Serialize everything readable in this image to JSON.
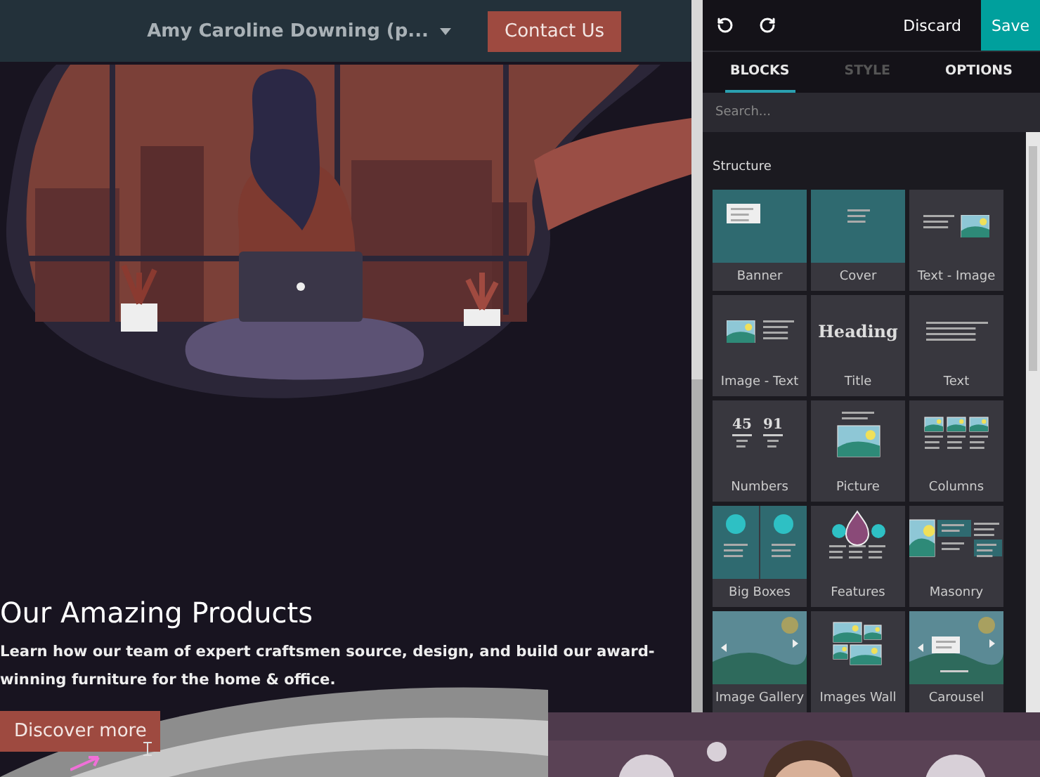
{
  "navbar": {
    "menu": "Amy Caroline Downing (p...",
    "cta": "Contact Us"
  },
  "hero": {
    "heading": "Our Amazing Products",
    "text": "Learn how our team of expert craftsmen source, design, and build our award-winning furniture for the home & office.",
    "button": "Discover more"
  },
  "editor": {
    "toolbar": {
      "discard": "Discard",
      "save": "Save"
    },
    "tabs": [
      {
        "label": "BLOCKS",
        "selected": true,
        "disabled": false
      },
      {
        "label": "STYLE",
        "selected": false,
        "disabled": true
      },
      {
        "label": "OPTIONS",
        "selected": false,
        "disabled": false
      }
    ],
    "search": {
      "placeholder": "Search..."
    },
    "section": "Structure",
    "blocks": [
      {
        "label": "Banner",
        "kind": "banner"
      },
      {
        "label": "Cover",
        "kind": "cover"
      },
      {
        "label": "Text - Image",
        "kind": "text-image"
      },
      {
        "label": "Image - Text",
        "kind": "image-text"
      },
      {
        "label": "Title",
        "kind": "title",
        "sample": "Heading"
      },
      {
        "label": "Text",
        "kind": "text"
      },
      {
        "label": "Numbers",
        "kind": "numbers",
        "sample": [
          "45",
          "91"
        ]
      },
      {
        "label": "Picture",
        "kind": "picture"
      },
      {
        "label": "Columns",
        "kind": "columns"
      },
      {
        "label": "Big Boxes",
        "kind": "big-boxes"
      },
      {
        "label": "Features",
        "kind": "features"
      },
      {
        "label": "Masonry",
        "kind": "masonry"
      },
      {
        "label": "Image Gallery",
        "kind": "gallery"
      },
      {
        "label": "Images Wall",
        "kind": "wall"
      },
      {
        "label": "Carousel",
        "kind": "carousel"
      }
    ]
  }
}
